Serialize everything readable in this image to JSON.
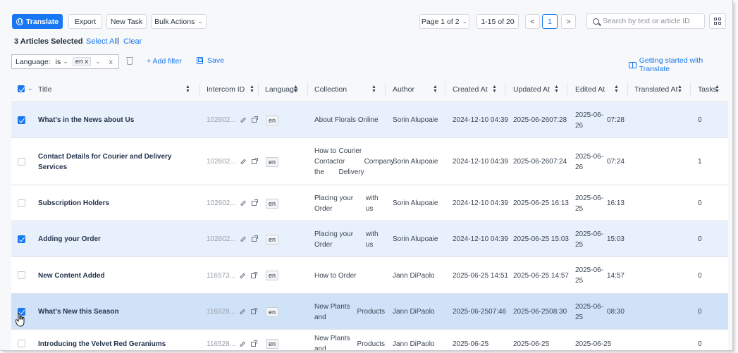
{
  "toolbar": {
    "translate_label": "Translate",
    "export_label": "Export",
    "new_task_label": "New Task",
    "bulk_actions_label": "Bulk Actions",
    "page_label": "Page 1 of 2",
    "range_label": "1-15 of 20",
    "current_page": "1",
    "prev_label": "<",
    "next_label": ">",
    "search_placeholder": "Search by text or article ID"
  },
  "selection": {
    "summary": "3 Articles Selected",
    "select_all": "Select All",
    "divider": "|",
    "clear": "Clear"
  },
  "filter": {
    "field": "Language:",
    "operator": "is",
    "value": "en",
    "remove_value": "x",
    "clear": "x",
    "add_filter": "+ Add filter",
    "save": "Save",
    "getting_started": "Getting started with Translate"
  },
  "table": {
    "columns": [
      "Title",
      "Intercom ID",
      "Language",
      "Collection",
      "Author",
      "Created At",
      "Updated At",
      "Edited At",
      "Translated At",
      "Tasks"
    ],
    "rows": [
      {
        "checked": true,
        "state": "sel",
        "title": "What's in the News about Us",
        "id": "102602...",
        "lang": "en",
        "collection": [
          "About Florals Online"
        ],
        "author": "Sorin Alupoaie",
        "created": [
          "2024-12-10 04:39"
        ],
        "updated": [
          "2025-06-26",
          "07:28"
        ],
        "edited": [
          "2025-06-26",
          "07:28"
        ],
        "translated": "",
        "tasks": "0"
      },
      {
        "checked": false,
        "state": "",
        "title": "Contact Details for Courier and Delivery Services",
        "id": "102602...",
        "lang": "en",
        "collection": [
          "How to Contact the",
          "Courier or Delivery",
          "Company"
        ],
        "author": "Sorin Alupoaie",
        "created": [
          "2024-12-10 04:39"
        ],
        "updated": [
          "2025-06-26",
          "07:24"
        ],
        "edited": [
          "2025-06-26",
          "07:24"
        ],
        "translated": "",
        "tasks": "1"
      },
      {
        "checked": false,
        "state": "",
        "title": "Subscription Holders",
        "id": "102602...",
        "lang": "en",
        "collection": [
          "Placing your Order",
          "with us"
        ],
        "author": "Sorin Alupoaie",
        "created": [
          "2024-12-10 04:39"
        ],
        "updated": [
          "2025-06-25 16:13"
        ],
        "edited": [
          "2025-06-25",
          "16:13"
        ],
        "translated": "",
        "tasks": "0"
      },
      {
        "checked": true,
        "state": "sel",
        "title": "Adding your Order",
        "id": "102602...",
        "lang": "en",
        "collection": [
          "Placing your Order",
          "with us"
        ],
        "author": "Sorin Alupoaie",
        "created": [
          "2024-12-10 04:39"
        ],
        "updated": [
          "2025-06-25 15:03"
        ],
        "edited": [
          "2025-06-25",
          "15:03"
        ],
        "translated": "",
        "tasks": "0"
      },
      {
        "checked": false,
        "state": "",
        "title": "New Content Added",
        "id": "116573...",
        "lang": "en",
        "collection": [
          "How to Order"
        ],
        "author": "Jann DiPaolo",
        "created": [
          "2025-06-25 14:51"
        ],
        "updated": [
          "2025-06-25 14:57"
        ],
        "edited": [
          "2025-06-25",
          "14:57"
        ],
        "translated": "",
        "tasks": "0"
      },
      {
        "checked": true,
        "state": "active",
        "title": "What's New this Season",
        "id": "116528...",
        "lang": "en",
        "collection": [
          "New Plants and",
          "Products"
        ],
        "author": "Jann DiPaolo",
        "created": [
          "2025-06-25",
          "07:46"
        ],
        "updated": [
          "2025-06-25",
          "08:30"
        ],
        "edited": [
          "2025-06-25",
          "08:30"
        ],
        "translated": "",
        "tasks": "0"
      },
      {
        "checked": false,
        "state": "",
        "title": "Introducing the Velvet Red Geraniums",
        "id": "116528...",
        "lang": "en",
        "collection": [
          "New Plants and",
          "Products"
        ],
        "author": "Jann DiPaolo",
        "created": [
          "2025-06-25"
        ],
        "updated": [
          "2025-06-25"
        ],
        "edited": [
          "2025-06-25"
        ],
        "translated": "",
        "tasks": "0"
      }
    ]
  },
  "colors": {
    "primary": "#1877f2",
    "selected_row": "#e8f1fb",
    "active_row": "#cfe2f8"
  }
}
